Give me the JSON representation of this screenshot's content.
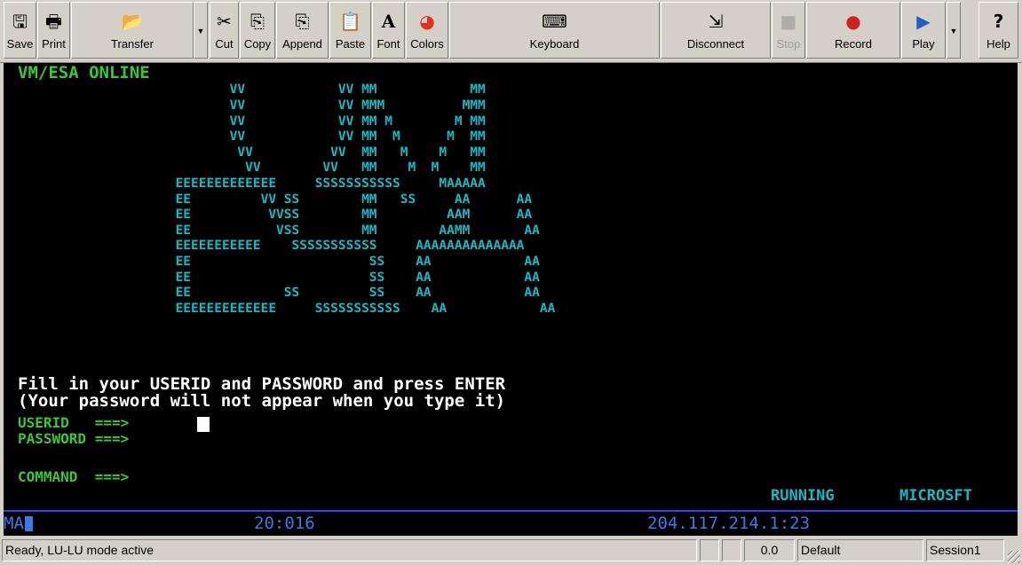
{
  "toolbar": {
    "buttons": [
      {
        "label": "Save",
        "icon": "floppy-icon",
        "glyph": "🖫"
      },
      {
        "label": "Print",
        "icon": "printer-icon",
        "glyph": "🖶"
      },
      {
        "label": "Transfer",
        "icon": "folder-open-icon",
        "glyph": "📂"
      },
      {
        "label": "Cut",
        "icon": "scissors-icon",
        "glyph": "✂"
      },
      {
        "label": "Copy",
        "icon": "copy-icon",
        "glyph": "⎘"
      },
      {
        "label": "Append",
        "icon": "append-icon",
        "glyph": "⎘"
      },
      {
        "label": "Paste",
        "icon": "clipboard-icon",
        "glyph": "📋"
      },
      {
        "label": "Font",
        "icon": "font-icon",
        "glyph": "A"
      },
      {
        "label": "Colors",
        "icon": "color-wheel-icon",
        "glyph": "◕"
      },
      {
        "label": "Keyboard",
        "icon": "keyboard-icon",
        "glyph": "⌨"
      },
      {
        "label": "Disconnect",
        "icon": "disconnect-icon",
        "glyph": "⇲"
      },
      {
        "label": "Stop",
        "icon": "stop-icon",
        "glyph": "■"
      },
      {
        "label": "Record",
        "icon": "record-icon",
        "glyph": "●"
      },
      {
        "label": "Play",
        "icon": "play-icon",
        "glyph": "▶"
      },
      {
        "label": "Help",
        "icon": "help-icon",
        "glyph": "?"
      }
    ]
  },
  "terminal": {
    "header": "VM/ESA ONLINE",
    "logo_lines": [
      "                VV            VV MM            MM",
      "                VV            VV MMM          MMM",
      "                VV            VV MM M        M MM",
      "                VV            VV MM  M      M  MM",
      "                 VV          VV  MM   M    M   MM",
      "                  VV        VV   MM    M  M    MM",
      "         EEEEEEEEEEEEE     SSSSSSSSSSS     MAAAAA",
      "         EE         VV SS        MM   SS     AA      AA",
      "         EE          VVSS        MM         AAM      AA",
      "         EE           VSS        MM        AAMM       AA",
      "         EEEEEEEEEEE    SSSSSSSSSSS     AAAAAAAAAAAAAA",
      "         EE                       SS    AA            AA",
      "         EE                       SS    AA            AA",
      "         EE            SS         SS    AA            AA",
      "         EEEEEEEEEEEEE     SSSSSSSSSSS    AA            AA"
    ],
    "instruction_1": "Fill in your USERID and PASSWORD and press ENTER",
    "instruction_2": "(Your password will not appear when you type it)",
    "userid_label": "USERID   ===>",
    "password_label": "PASSWORD ===>",
    "command_label": "COMMAND  ===>",
    "status_running": "RUNNING",
    "status_system": "MICROSFT"
  },
  "oia": {
    "mode": "MA",
    "cursor_pos": "20:016",
    "host": "204.117.214.1:23"
  },
  "statusbar": {
    "message": "Ready, LU-LU mode active",
    "value": "0.0",
    "profile": "Default",
    "session": "Session1"
  },
  "colors": {
    "terminal_bg": "#000000",
    "text_green": "#38c838",
    "logo_cyan": "#18b8c4",
    "oia_blue": "#3c78e8"
  }
}
